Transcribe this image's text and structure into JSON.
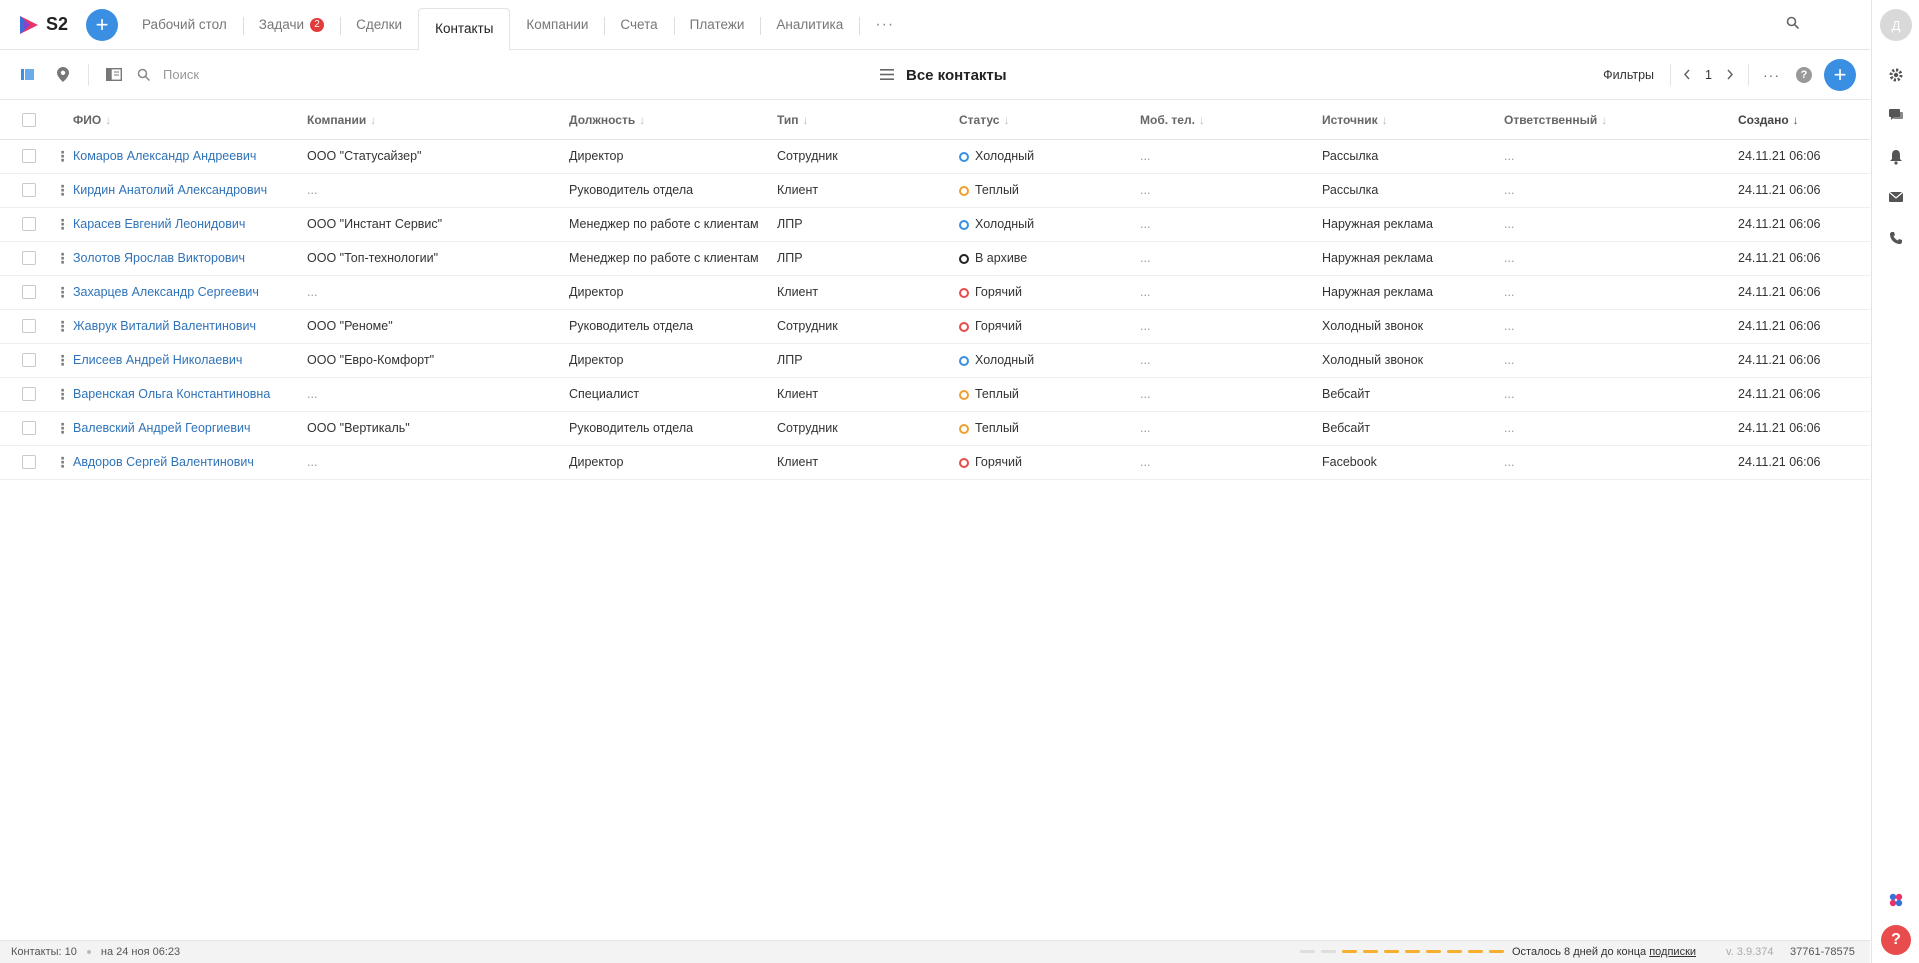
{
  "app": {
    "logo": "S2"
  },
  "nav": {
    "tabs": [
      {
        "label": "Рабочий стол"
      },
      {
        "label": "Задачи",
        "badge": "2"
      },
      {
        "label": "Сделки"
      },
      {
        "label": "Контакты",
        "active": true
      },
      {
        "label": "Компании"
      },
      {
        "label": "Счета"
      },
      {
        "label": "Платежи"
      },
      {
        "label": "Аналитика"
      }
    ],
    "more": "···"
  },
  "user": {
    "avatar_letter": "Д"
  },
  "toolbar": {
    "search_placeholder": "Поиск",
    "view_title": "Все контакты",
    "filters_label": "Фильтры",
    "page": "1",
    "more": "···"
  },
  "table": {
    "columns": [
      "ФИО",
      "Компании",
      "Должность",
      "Тип",
      "Статус",
      "Моб. тел.",
      "Источник",
      "Ответственный",
      "Создано"
    ],
    "rows": [
      {
        "fio": "Комаров Александр Андреевич",
        "company": "ООО \"Статусайзер\"",
        "position": "Директор",
        "type": "Сотрудник",
        "status": "Холодный",
        "status_color": "#3a8fe3",
        "phone": "...",
        "source": "Рассылка",
        "owner": "...",
        "created": "24.11.21 06:06"
      },
      {
        "fio": "Кирдин Анатолий Александрович",
        "company": "...",
        "position": "Руководитель отдела",
        "type": "Клиент",
        "status": "Теплый",
        "status_color": "#f0a030",
        "phone": "...",
        "source": "Рассылка",
        "owner": "...",
        "created": "24.11.21 06:06"
      },
      {
        "fio": "Карасев Евгений Леонидович",
        "company": "ООО \"Инстант Сервис\"",
        "position": "Менеджер по работе с клиентам",
        "type": "ЛПР",
        "status": "Холодный",
        "status_color": "#3a8fe3",
        "phone": "...",
        "source": "Наружная реклама",
        "owner": "...",
        "created": "24.11.21 06:06"
      },
      {
        "fio": "Золотов Ярослав Викторович",
        "company": "ООО \"Топ-технологии\"",
        "position": "Менеджер по работе с клиентам",
        "type": "ЛПР",
        "status": "В архиве",
        "status_color": "#222222",
        "phone": "...",
        "source": "Наружная реклама",
        "owner": "...",
        "created": "24.11.21 06:06"
      },
      {
        "fio": "Захарцев Александр Сергеевич",
        "company": "...",
        "position": "Директор",
        "type": "Клиент",
        "status": "Горячий",
        "status_color": "#e84c4c",
        "phone": "...",
        "source": "Наружная реклама",
        "owner": "...",
        "created": "24.11.21 06:06"
      },
      {
        "fio": "Жаврук Виталий Валентинович",
        "company": "ООО \"Реноме\"",
        "position": "Руководитель отдела",
        "type": "Сотрудник",
        "status": "Горячий",
        "status_color": "#e84c4c",
        "phone": "...",
        "source": "Холодный звонок",
        "owner": "...",
        "created": "24.11.21 06:06"
      },
      {
        "fio": "Елисеев Андрей Николаевич",
        "company": "ООО \"Евро-Комфорт\"",
        "position": "Директор",
        "type": "ЛПР",
        "status": "Холодный",
        "status_color": "#3a8fe3",
        "phone": "...",
        "source": "Холодный звонок",
        "owner": "...",
        "created": "24.11.21 06:06"
      },
      {
        "fio": "Варенская Ольга Константиновна",
        "company": "...",
        "position": "Специалист",
        "type": "Клиент",
        "status": "Теплый",
        "status_color": "#f0a030",
        "phone": "...",
        "source": "Вебсайт",
        "owner": "...",
        "created": "24.11.21 06:06"
      },
      {
        "fio": "Валевский Андрей Георгиевич",
        "company": "ООО \"Вертикаль\"",
        "position": "Руководитель отдела",
        "type": "Сотрудник",
        "status": "Теплый",
        "status_color": "#f0a030",
        "phone": "...",
        "source": "Вебсайт",
        "owner": "...",
        "created": "24.11.21 06:06"
      },
      {
        "fio": "Авдоров Сергей Валентинович",
        "company": "...",
        "position": "Директор",
        "type": "Клиент",
        "status": "Горячий",
        "status_color": "#e84c4c",
        "phone": "...",
        "source": "Facebook",
        "owner": "...",
        "created": "24.11.21 06:06"
      }
    ]
  },
  "footer": {
    "count": "Контакты: 10",
    "updated": "на 24 ноя 06:23",
    "subscription_progress": {
      "filled": 8,
      "total": 10
    },
    "remaining_prefix": "Осталось 8 дней до конца ",
    "remaining_link": "подписки",
    "version": "v. 3.9.374",
    "code": "37761-78575"
  },
  "colors": {
    "accent": "#3a8fe3",
    "link": "#2f73b8",
    "danger": "#e84c4c",
    "warning": "#f5ae2e"
  }
}
